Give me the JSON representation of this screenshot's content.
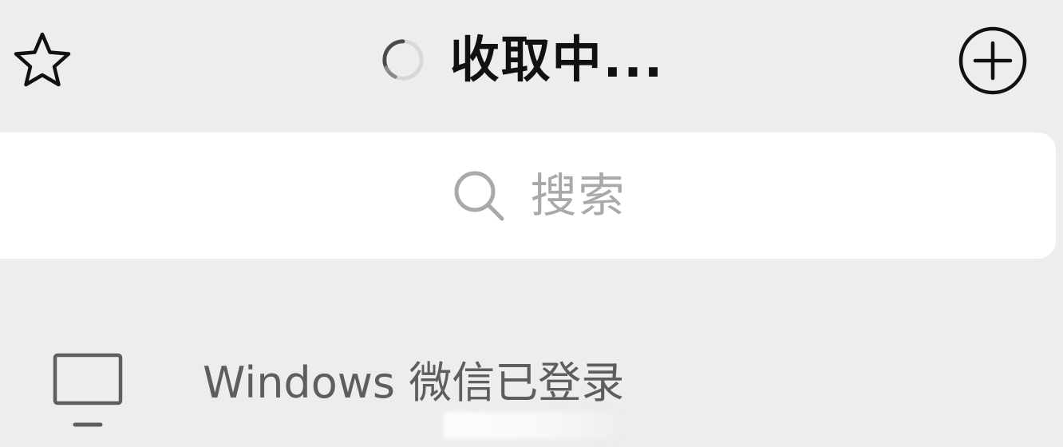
{
  "header": {
    "title": "收取中...",
    "left_icon": "star-outline-icon",
    "status_icon": "loading-spinner-icon",
    "right_icon": "add-circle-icon"
  },
  "search": {
    "placeholder": "搜索",
    "icon": "search-icon"
  },
  "login_notice": {
    "icon": "monitor-icon",
    "label": "Windows 微信已登录"
  },
  "colors": {
    "background": "#ededed",
    "search_bg": "#ffffff",
    "title_text": "#111111",
    "placeholder_text": "#a9a9a9",
    "notice_text": "#5e5e5e",
    "icon_stroke": "#111111"
  }
}
